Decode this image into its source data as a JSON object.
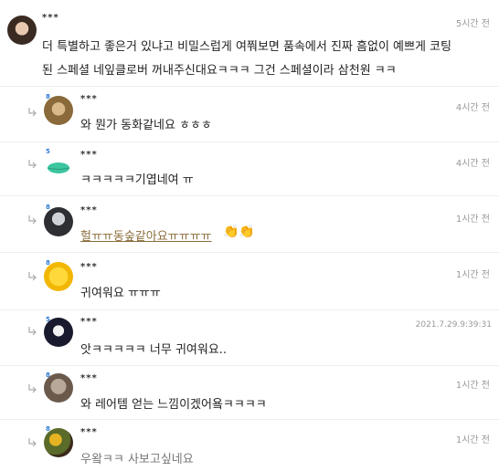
{
  "comments": [
    {
      "name": "***",
      "time": "5시간 전",
      "lines": [
        "더 특별하고 좋은거 있냐고 비밀스럽게 여쭤보면 품속에서 진짜 흠없이 예쁘게 코팅",
        "된 스페셜 네잎클로버 꺼내주신대요ㅋㅋㅋ 그건 스페셜이라 삼천원 ㅋㅋ"
      ]
    },
    {
      "name": "***",
      "badge": "8",
      "time": "4시간 전",
      "text": "와 뭔가 동화같네요 ㅎㅎㅎ"
    },
    {
      "name": "***",
      "badge": "5",
      "time": "4시간 전",
      "text": "ㅋㅋㅋㅋㅋ기엽네여 ㅠ"
    },
    {
      "name": "***",
      "badge": "8",
      "time": "1시간 전",
      "text": "헐ㅠㅠ동숲같아요ㅠㅠㅠㅠ",
      "emoji": "👏👏"
    },
    {
      "name": "***",
      "badge": "8",
      "time": "1시간 전",
      "text": "귀여워요 ㅠㅠㅠ"
    },
    {
      "name": "***",
      "badge": "5",
      "time": "2021.7.29.9:39:31",
      "text": "앗ㅋㅋㅋㅋㅋ 너무 귀여워요.."
    },
    {
      "name": "***",
      "badge": "8",
      "time": "1시간 전",
      "text": "와 레어템 얻는 느낌이겠어욬ㅋㅋㅋㅋ"
    },
    {
      "name": "***",
      "badge": "8",
      "time": "1시간 전",
      "text": "우왘ㅋㅋ 사보고싶네요"
    }
  ]
}
